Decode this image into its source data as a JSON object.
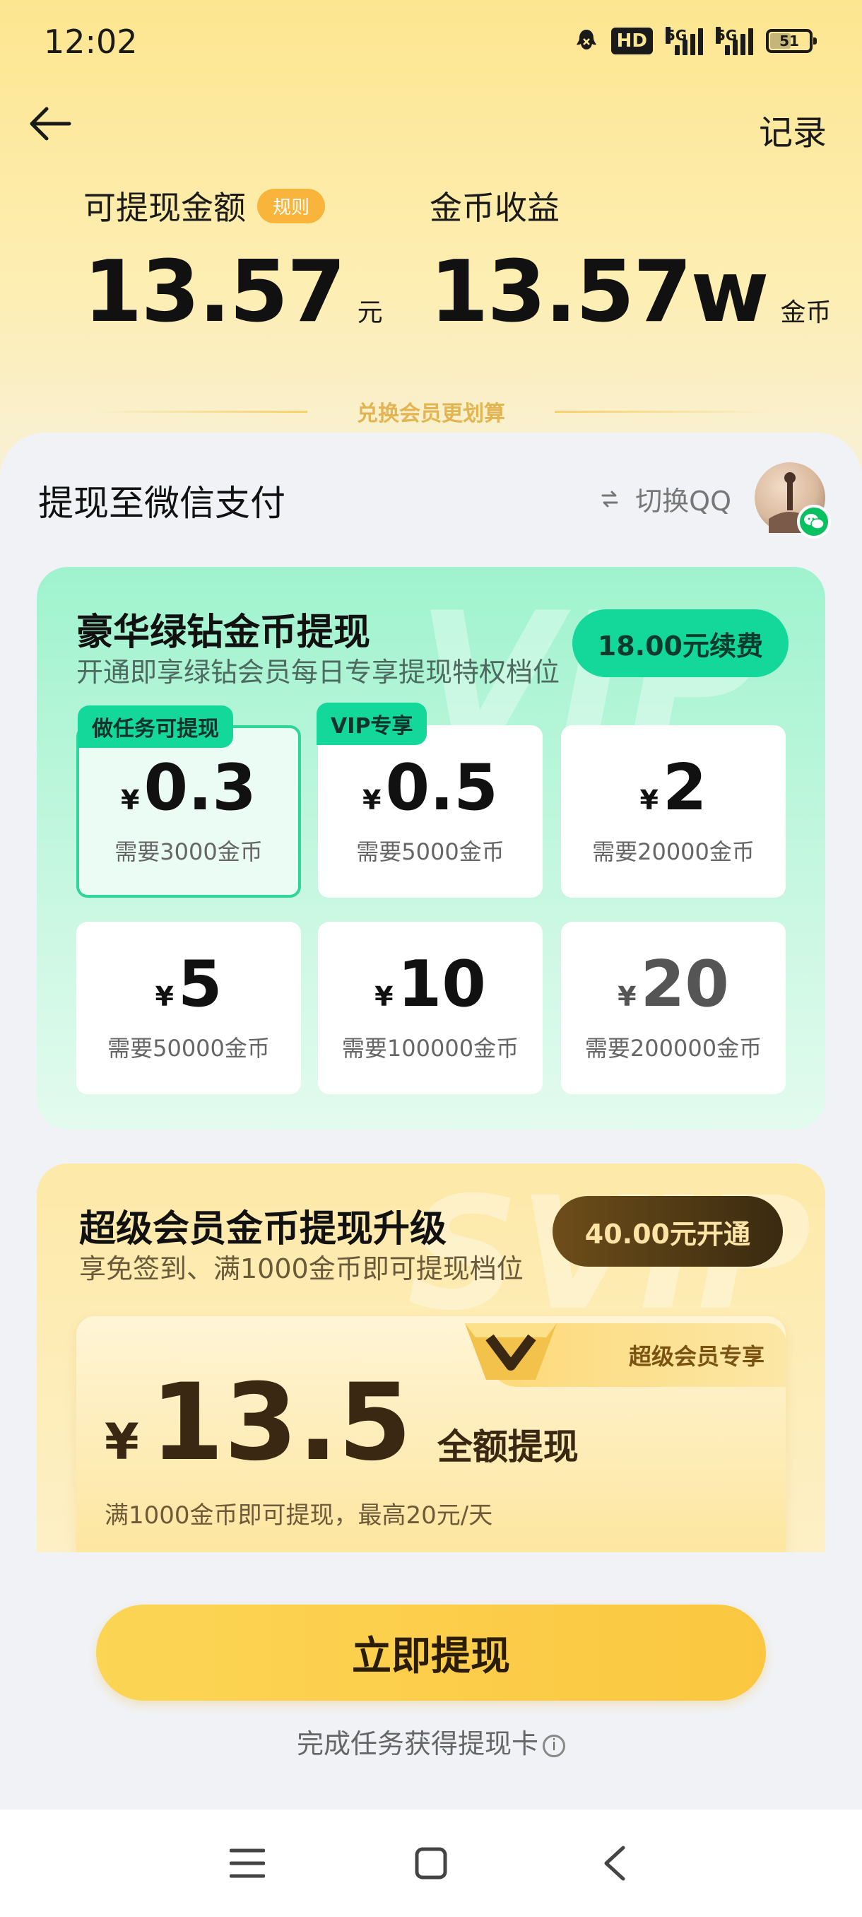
{
  "status_bar": {
    "time": "12:02",
    "network": "5G",
    "hd_label": "HD",
    "battery": "51"
  },
  "header": {
    "record_label": "记录"
  },
  "balance": {
    "withdrawable_label": "可提现金额",
    "rule_label": "规则",
    "withdrawable_value": "13.57",
    "withdrawable_unit": "元",
    "coin_label": "金币收益",
    "coin_value": "13.57w",
    "coin_unit": "金币"
  },
  "exchange_banner": "兑换会员更划算",
  "withdraw_target": {
    "label": "提现至微信支付",
    "switch_label": "切换QQ"
  },
  "vip_section": {
    "watermark": "VIP",
    "title": "豪华绿钻金币提现",
    "subtitle": "开通即享绿钻会员每日专享提现特权档位",
    "renew_button": "18.00元续费",
    "currency": "¥",
    "tiers": [
      {
        "tag": "做任务可提现",
        "amount": "0.3",
        "need": "需要3000金币"
      },
      {
        "tag": "VIP专享",
        "amount": "0.5",
        "need": "需要5000金币"
      },
      {
        "tag": "",
        "amount": "2",
        "need": "需要20000金币"
      },
      {
        "tag": "",
        "amount": "5",
        "need": "需要50000金币"
      },
      {
        "tag": "",
        "amount": "10",
        "need": "需要100000金币"
      },
      {
        "tag": "",
        "amount": "20",
        "need": "需要200000金币"
      }
    ]
  },
  "svip_section": {
    "watermark": "SVIP",
    "title": "超级会员金币提现升级",
    "subtitle": "享免签到、满1000金币即可提现档位",
    "open_button": "40.00元开通",
    "exclusive_label": "超级会员专享",
    "currency": "¥",
    "amount": "13.5",
    "full_label": "全额提现",
    "note": "满1000金币即可提现，最高20元/天"
  },
  "actions": {
    "withdraw_button": "立即提现",
    "task_hint": "完成任务获得提现卡"
  },
  "colors": {
    "accent_green": "#14d89a",
    "accent_yellow": "#fbc740",
    "wechat_green": "#07c160"
  }
}
